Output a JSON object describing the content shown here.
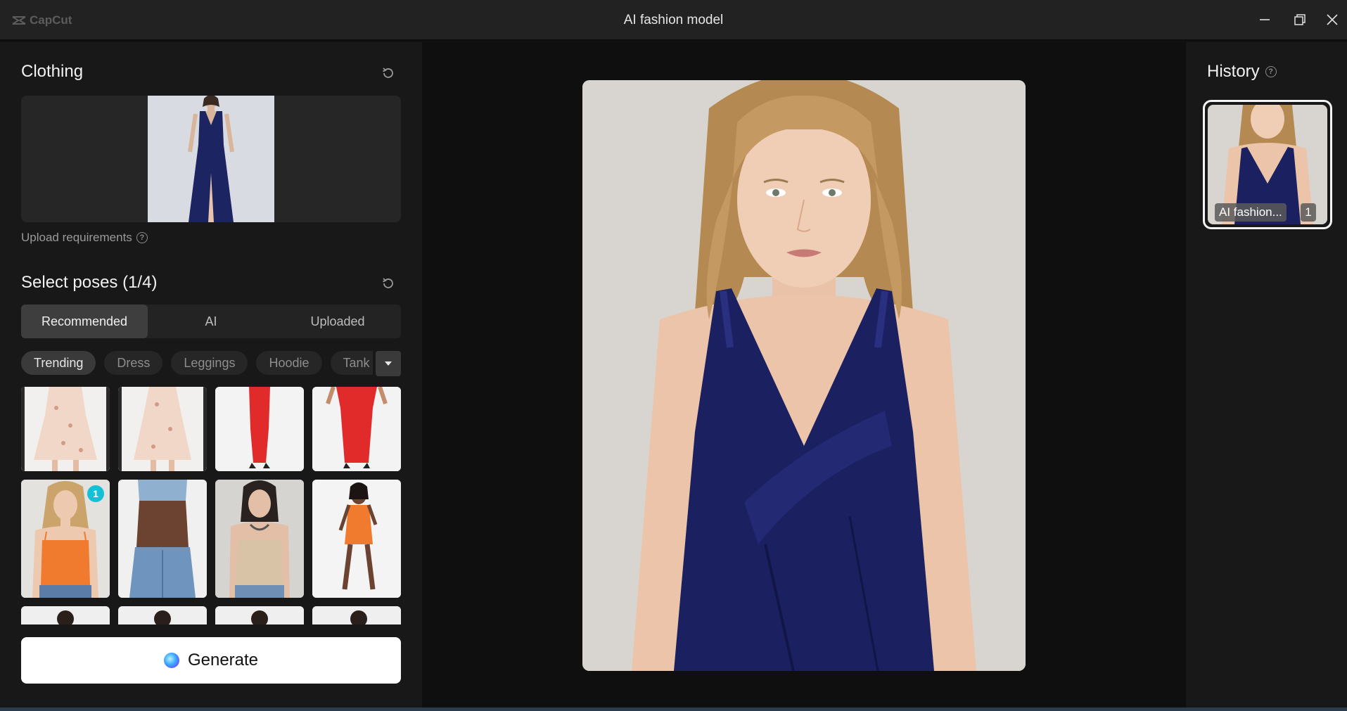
{
  "window": {
    "app_name": "CapCut",
    "title": "AI fashion model"
  },
  "clothing": {
    "title": "Clothing",
    "upload_requirements": "Upload requirements"
  },
  "poses": {
    "title": "Select poses (1/4)",
    "tabs": [
      {
        "label": "Recommended",
        "active": true
      },
      {
        "label": "AI",
        "active": false
      },
      {
        "label": "Uploaded",
        "active": false
      }
    ],
    "chips": [
      {
        "label": "Trending",
        "active": true
      },
      {
        "label": "Dress",
        "active": false
      },
      {
        "label": "Leggings",
        "active": false
      },
      {
        "label": "Hoodie",
        "active": false
      },
      {
        "label": "Tank",
        "active": false
      }
    ],
    "selected_badge": "1"
  },
  "generate": {
    "label": "Generate"
  },
  "history": {
    "title": "History",
    "items": [
      {
        "label": "AI fashion...",
        "count": "1"
      }
    ]
  },
  "colors": {
    "accent_badge": "#14c0d6",
    "dress_navy": "#1b2060"
  }
}
